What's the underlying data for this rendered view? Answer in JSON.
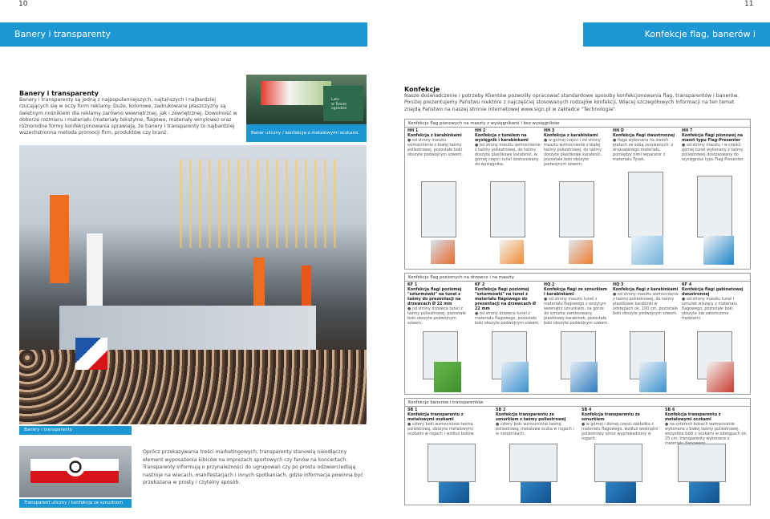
{
  "page": {
    "left_number": "10",
    "right_number": "11"
  },
  "header": {
    "left_title": "Banery i transparenty",
    "right_title": "Konfekcje flag, banerów i transparentów"
  },
  "intro": {
    "title": "Banery i transparenty",
    "text": "Banery i transparenty są jedną z najpopularniejszych, najtańszych i najbardziej rzucających się w oczy form reklamy. Duże, kolorowe, zadrukowane płaszczyzny są świetnym nośnikiem dla reklamy zarówno wewnętrznej, jak i zewnętrznej. Dowolność w doborze rozmiaru i materiału (materiały tekstylne, flagowe, materiały winylowe) oraz różnorodne formy konfekcjonowania sprawiają, że banery i transparenty to najbardziej wszechstronna metoda promocji firm, produktów czy branż."
  },
  "photos": {
    "top_caption": "Baner uliczny / konfekcja z metalowymi oczkami",
    "stadium_caption": "Banery i transparenty",
    "street_caption": "Transparent uliczny / konfekcja ze sznurkiem",
    "banner_text": "Lato\nw Twoim\nogrodzie"
  },
  "body_text": "Oprócz przekazywania treści marketingowych, transparenty stanowią nieodłączny element wyposażenia kibiców na imprezach sportowych czy fanów na koncertach. Transparenty informują o przynależności do ugrupowań czy po prostu odzwierciedlają nastroje na wiecach, manifestacjach i innych spotkaniach, gdzie informacja powinna być przekazana w prosty i czytelny sposób.",
  "konfekcje": {
    "title": "Konfekcje",
    "text": "Nasze doświadczenie i potrzeby Klientów pozwoliły opracować standardowe sposoby konfekcjonowania flag, transparentów i banerów. Poniżej prezentujemy Państwu niektóre z najczęściej stosowanych rodzajów konfekcji. Więcej szczegółowych informacji na ten temat znajdą Państwo na naszej stronie internetowej www.sign.pl w zakładce \"Technologia\"."
  },
  "sections": [
    {
      "title": "Konfekcje flag pionowych na maszty z wysięgnikami i bez wysięgników",
      "items": [
        {
          "code": "HH 1",
          "name": "Konfekcja z karabinkami",
          "text": "● od strony masztu wzmocnienie z białej taśmy poliestrowej, pozostałe boki obszyte podwójnym szwem."
        },
        {
          "code": "HH 2",
          "name": "Konfekcja z tunelem na wysięgnik i karabinkami",
          "text": "● od strony masztu wzmocnienie z taśmy poliestrowej, do taśmy doszyte plastikowe karabinki, w górnej części tunel dostosowany do wysięgnika."
        },
        {
          "code": "HH 3",
          "name": "Konfekcja z karabinkami",
          "text": "● w górnej części i od strony masztu wzmocnienie z białej taśmy poliestrowej, do taśmy doszyte plastikowe karabinki, pozostałe boki obszyte podwójnym szwem."
        },
        {
          "code": "HH D",
          "name": "Konfekcja flagi dwustronnej",
          "text": "● flaga wykonana na dwóch płatach ze sobą zszywanych, z drukowanego materiału, pomiędzy nimi separator z materiału Tyvek."
        },
        {
          "code": "HH 7",
          "name": "Konfekcja flagi pionowej na maszt typu Flag-Presenter",
          "text": "● od strony masztu i w części górnej tunel wykonany z taśmy poliestrowej dostosowany do wysięgnika typu Flag-Presenter."
        }
      ]
    },
    {
      "title": "Konfekcje flag poziomych na drzewce i na maszty",
      "items": [
        {
          "code": "KF 1",
          "name": "Konfekcja flagi poziomej \"szturmówki\" na tunel z taśmy do prezentacji na drzewcach Ø 22 mm",
          "text": "● od strony drzewca tunel z taśmy poliestrowej, pozostałe boki obszyte podwójnym szwem."
        },
        {
          "code": "KF 2",
          "name": "Konfekcja flagi poziomej \"szturmówki\" na tunel z materiału flagowego do prezentacji na drzewcach Ø 22 mm",
          "text": "● od strony drzewca tunel z materiału flagowego, pozostałe boki obszyte podwójnym szwem."
        },
        {
          "code": "HQ 2",
          "name": "Konfekcja flagi ze sznurkiem i karabinkami",
          "text": "● od strony masztu tunel z materiału flagowego z wszytym wewnątrz sznurkiem, na górze do sznurka zamocowany plastikowy karabinek, pozostałe boki obszyte podwójnym szwem."
        },
        {
          "code": "HQ 3",
          "name": "Konfekcja flagi z karabinkami",
          "text": "● od strony masztu wzmocnienie z taśmy poliestrowej, do taśmy plastikowe karabinki w odstępach ok. 100 cm, pozostałe boki obszyte podwójnym szwem."
        },
        {
          "code": "KF 4",
          "name": "Konfekcja flagi gabinetowej dwustronnej",
          "text": "● od strony masztu tunel i sznurek wiszący z materiału flagowego, pozostałe boki obszyte lub zakończone frędzlami."
        }
      ]
    },
    {
      "title": "Konfekcje banerów i transparentów",
      "items": [
        {
          "code": "SB 1",
          "name": "Konfekcja transparentu z metalowymi oczkami",
          "text": "● cztery boki wzmocnione taśmą poliestrową, obszyte metalowymi oczkami w rogach i wzdłuż boków."
        },
        {
          "code": "SB 2",
          "name": "Konfekcja transparentu ze sznurkiem z taśmy poliestrowej",
          "text": "● cztery boki wzmocnione taśmą poliestrową, metalowe oczka w rogach i w narożnikach."
        },
        {
          "code": "SB 4",
          "name": "Konfekcja transparentu ze sznurkiem",
          "text": "● w górnej i dolnej części zakładka z materiału flagowego, wzdłuż wewnątrz poliestrowy sznur wyprowadzony w rogach."
        },
        {
          "code": "SB 6",
          "name": "Konfekcja transparentu z metalowymi oczkami",
          "text": "● na czterech bokach wzmocnienie wykonane z białej taśmy poliestrowej, wszystkie boki z oczkami w odstępach ok. 25 cm, transparenty wykonane z materiału flagowego."
        }
      ]
    }
  ]
}
